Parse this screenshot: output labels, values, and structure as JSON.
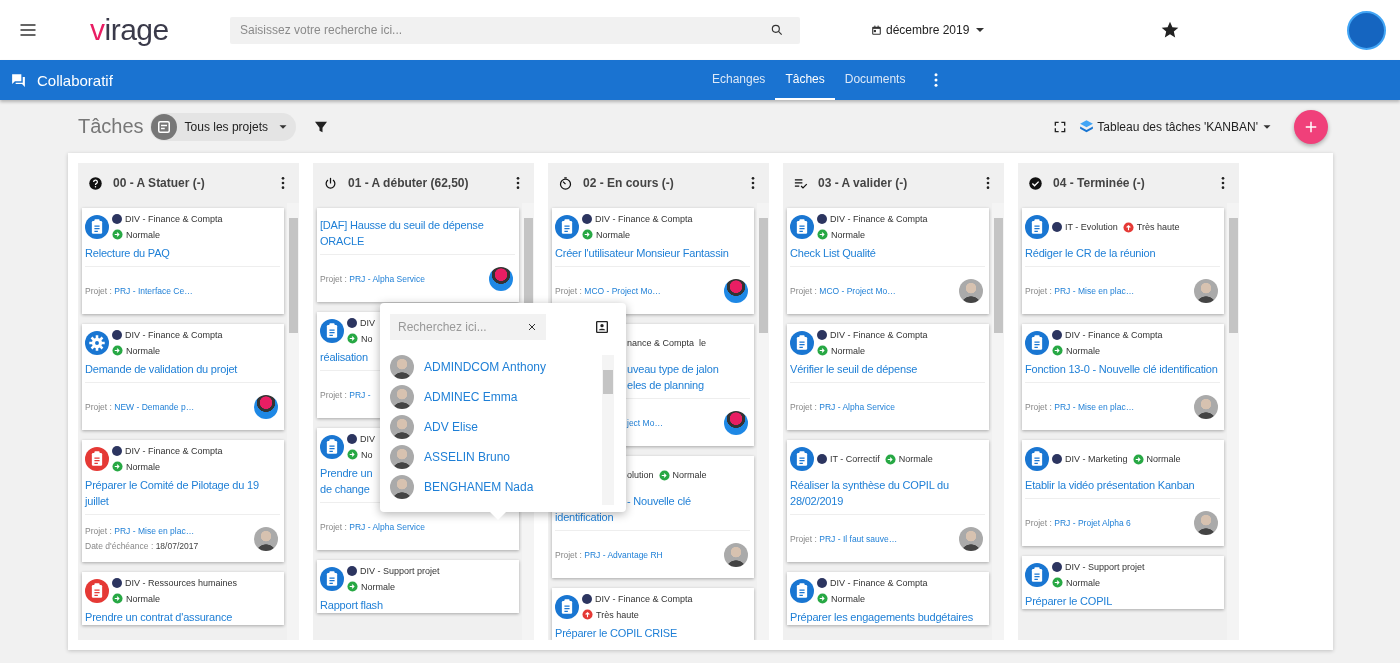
{
  "app_bar": {
    "logo": "virage",
    "search_placeholder": "Saisissez votre recherche ici...",
    "period": "décembre 2019"
  },
  "module_bar": {
    "title": "Collaboratif",
    "tabs": [
      {
        "label": "Echanges",
        "selected": false
      },
      {
        "label": "Tâches",
        "selected": true
      },
      {
        "label": "Documents",
        "selected": false
      }
    ]
  },
  "toolbar": {
    "title": "Tâches",
    "project_filter": "Tous les projets",
    "view": "Tableau des tâches 'KANBAN'"
  },
  "columns": [
    {
      "kind": "question",
      "title": "00 - A Statuer (-)",
      "cards": [
        {
          "kind": "clipboard",
          "color": "#1976d2",
          "division": "DIV - Finance & Compta",
          "priority": {
            "kind": "normal",
            "label": "Normale"
          },
          "title": "Relecture du PAQ",
          "project_label": "Projet :",
          "project": "PRJ - Interface Ce…"
        },
        {
          "kind": "gear",
          "color": "#1976d2",
          "division": "DIV - Finance & Compta",
          "priority": {
            "kind": "normal",
            "label": "Normale"
          },
          "title": "Demande de validation du projet",
          "project_label": "Projet :",
          "project": "NEW - Demande p…",
          "assignee": {
            "kind": "badge"
          }
        },
        {
          "kind": "clipboard",
          "color": "#e53935",
          "division": "DIV - Finance & Compta",
          "priority": {
            "kind": "normal",
            "label": "Normale"
          },
          "title": "Préparer le Comité de Pilotage du 19 juillet",
          "project_label": "Projet :",
          "project": "PRJ - Mise en plac…",
          "due_label": "Date d'échéance :",
          "due": "18/07/2017",
          "assignee": {
            "kind": "photo"
          }
        },
        {
          "kind": "clipboard",
          "color": "#e53935",
          "division": "DIV - Ressources humaines",
          "priority": {
            "kind": "normal",
            "label": "Normale"
          },
          "title": "Prendre un contrat d'assurance"
        }
      ]
    },
    {
      "kind": "power",
      "title": "01 - A débuter (62,50)",
      "cards": [
        {
          "kind": "plain",
          "title": "[DAF] Hausse du seuil de dépense ORACLE",
          "project_label": "Projet :",
          "project": "PRJ - Alpha Service",
          "assignee": {
            "kind": "badge"
          }
        },
        {
          "kind": "clipboard",
          "color": "#1976d2",
          "division": "DIV",
          "priority": {
            "kind": "normal",
            "label": "No"
          },
          "title": "réalisation",
          "project_label": "Projet :",
          "project": "PRJ -"
        },
        {
          "kind": "clipboard",
          "color": "#1976d2",
          "division": "DIV",
          "priority": {
            "kind": "normal",
            "label": "No"
          },
          "title": "Prendre un\nde change",
          "project_label": "Projet :",
          "project": "PRJ - Alpha Service"
        },
        {
          "kind": "clipboard",
          "color": "#1976d2",
          "division": "DIV - Support projet",
          "priority": {
            "kind": "normal",
            "label": "Normale"
          },
          "title": "Rapport flash"
        }
      ]
    },
    {
      "kind": "timer",
      "title": "02 - En cours (-)",
      "cards": [
        {
          "kind": "clipboard",
          "color": "#1976d2",
          "division": "DIV - Finance & Compta",
          "priority": {
            "kind": "normal",
            "label": "Normale"
          },
          "title": "Créer l'utilisateur Monsieur Fantassin",
          "project_label": "Projet :",
          "project": "MCO - Project Mo…",
          "assignee": {
            "kind": "badge"
          }
        },
        {
          "kind": "covered_left",
          "division": "nance & Compta",
          "priority": {
            "kind": "hidden",
            "label": "le"
          },
          "title": "uveau type de jalon\neles de planning",
          "project": "ject Mo…",
          "assignee": {
            "kind": "badge"
          }
        },
        {
          "kind": "covered_corner",
          "division": "olution",
          "priority": {
            "kind": "normal",
            "label": "Normale"
          },
          "title": "- Nouvelle clé identification",
          "project_label": "Projet :",
          "project": "PRJ - Advantage RH",
          "assignee": {
            "kind": "photo"
          }
        },
        {
          "kind": "clipboard",
          "color": "#1976d2",
          "division": "DIV - Finance & Compta",
          "priority": {
            "kind": "very_high",
            "label": "Très haute"
          },
          "title": "Préparer le COPIL CRISE"
        }
      ]
    },
    {
      "kind": "checklist",
      "title": "03 - A valider (-)",
      "cards": [
        {
          "kind": "clipboard",
          "color": "#1976d2",
          "division": "DIV - Finance & Compta",
          "priority": {
            "kind": "normal",
            "label": "Normale"
          },
          "title": "Check List Qualité",
          "project_label": "Projet :",
          "project": "MCO - Project Mo…",
          "assignee": {
            "kind": "photo"
          }
        },
        {
          "kind": "clipboard",
          "color": "#1976d2",
          "division": "DIV - Finance & Compta",
          "priority": {
            "kind": "normal",
            "label": "Normale"
          },
          "title": "Vérifier le seuil de dépense",
          "project_label": "Projet :",
          "project": "PRJ - Alpha Service"
        },
        {
          "kind": "clipboard",
          "color": "#1976d2",
          "division": "IT - Correctif",
          "priority": {
            "kind": "normal",
            "label": "Normale"
          },
          "title": "Réaliser la synthèse du COPIL du 28/02/2019",
          "project_label": "Projet :",
          "project": "PRJ - Il faut sauve…",
          "assignee": {
            "kind": "photo"
          }
        },
        {
          "kind": "clipboard",
          "color": "#1976d2",
          "division": "DIV - Finance & Compta",
          "priority": {
            "kind": "normal",
            "label": "Normale"
          },
          "title": "Préparer les engagements budgétaires"
        }
      ]
    },
    {
      "kind": "done",
      "title": "04 - Terminée (-)",
      "cards": [
        {
          "kind": "clipboard",
          "color": "#1976d2",
          "division": "IT - Evolution",
          "priority": {
            "kind": "very_high",
            "label": "Très haute"
          },
          "title": "Rédiger le CR de la réunion",
          "project_label": "Projet :",
          "project": "PRJ - Mise en plac…",
          "assignee": {
            "kind": "photo"
          }
        },
        {
          "kind": "clipboard",
          "color": "#1976d2",
          "division": "DIV - Finance & Compta",
          "priority": {
            "kind": "normal",
            "label": "Normale"
          },
          "title": "Fonction 13-0 - Nouvelle clé identification",
          "project_label": "Projet :",
          "project": "PRJ - Mise en plac…",
          "assignee": {
            "kind": "photo"
          }
        },
        {
          "kind": "clipboard",
          "color": "#1976d2",
          "division": "DIV - Marketing",
          "priority": {
            "kind": "normal",
            "label": "Normale"
          },
          "title": "Etablir la vidéo présentation Kanban",
          "project_label": "Projet :",
          "project": "PRJ - Projet Alpha 6",
          "assignee": {
            "kind": "photo"
          }
        },
        {
          "kind": "clipboard",
          "color": "#1976d2",
          "division": "DIV - Support projet",
          "priority": {
            "kind": "normal",
            "label": "Normale"
          },
          "title": "Préparer le COPIL"
        }
      ]
    }
  ],
  "assignee_popup": {
    "placeholder": "Recherchez ici...",
    "people": [
      {
        "name": "ADMINDCOM Anthony"
      },
      {
        "name": "ADMINEC Emma"
      },
      {
        "name": "ADV Elise"
      },
      {
        "name": "ASSELIN Bruno"
      },
      {
        "name": "BENGHANEM Nada"
      }
    ]
  }
}
